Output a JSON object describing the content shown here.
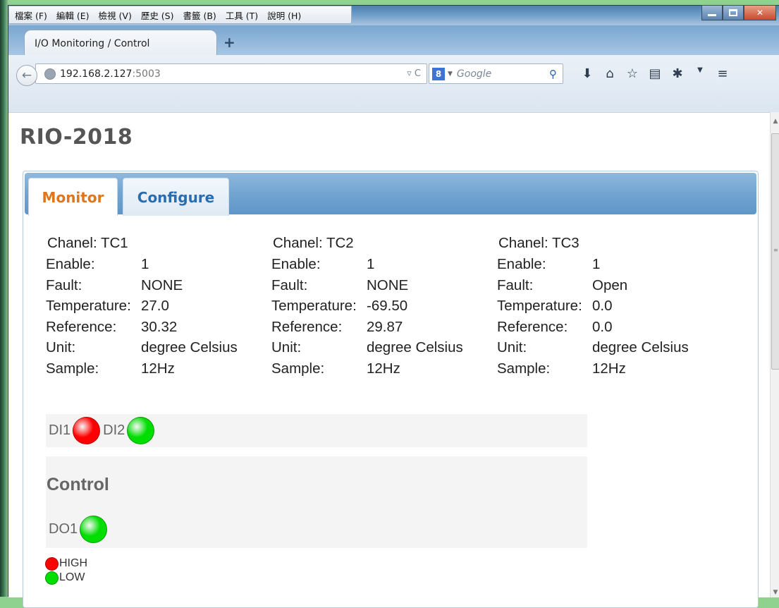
{
  "menu": {
    "items": [
      "檔案 (F)",
      "編輯 (E)",
      "檢視 (V)",
      "歷史 (S)",
      "書籤 (B)",
      "工具 (T)",
      "說明 (H)"
    ]
  },
  "browser_tab": {
    "title": "I/O Monitoring / Control",
    "new_tab_symbol": "+"
  },
  "address_bar": {
    "host": "192.168.2.127",
    "port": ":5003"
  },
  "search_bar": {
    "engine_badge": "8",
    "placeholder": "Google"
  },
  "page": {
    "title": "RIO-2018",
    "tabs": [
      {
        "label": "Monitor",
        "active": true
      },
      {
        "label": "Configure",
        "active": false
      }
    ],
    "field_labels": {
      "enable": "Enable:",
      "fault": "Fault:",
      "temperature": "Temperature:",
      "reference": "Reference:",
      "unit": "Unit:",
      "sample": "Sample:"
    },
    "channels": [
      {
        "title": "Chanel: TC1",
        "enable": "1",
        "fault": "NONE",
        "temperature": "27.0",
        "reference": "30.32",
        "unit": "degree Celsius",
        "sample": "12Hz"
      },
      {
        "title": "Chanel: TC2",
        "enable": "1",
        "fault": "NONE",
        "temperature": "-69.50",
        "reference": "29.87",
        "unit": "degree Celsius",
        "sample": "12Hz"
      },
      {
        "title": "Chanel: TC3",
        "enable": "1",
        "fault": "Open",
        "temperature": "0.0",
        "reference": "0.0",
        "unit": "degree Celsius",
        "sample": "12Hz"
      }
    ],
    "digital_inputs": [
      {
        "label": "DI1",
        "state": "HIGH"
      },
      {
        "label": "DI2",
        "state": "LOW"
      }
    ],
    "control": {
      "title": "Control",
      "outputs": [
        {
          "label": "DO1",
          "state": "LOW"
        }
      ]
    },
    "legend": [
      {
        "label": "HIGH",
        "color": "#ff0000"
      },
      {
        "label": "LOW",
        "color": "#00dd00"
      }
    ]
  },
  "colors": {
    "high": "#ff0000",
    "low": "#00dd00",
    "active_tab_text": "#e0761c",
    "inactive_tab_text": "#2a6cb0"
  }
}
